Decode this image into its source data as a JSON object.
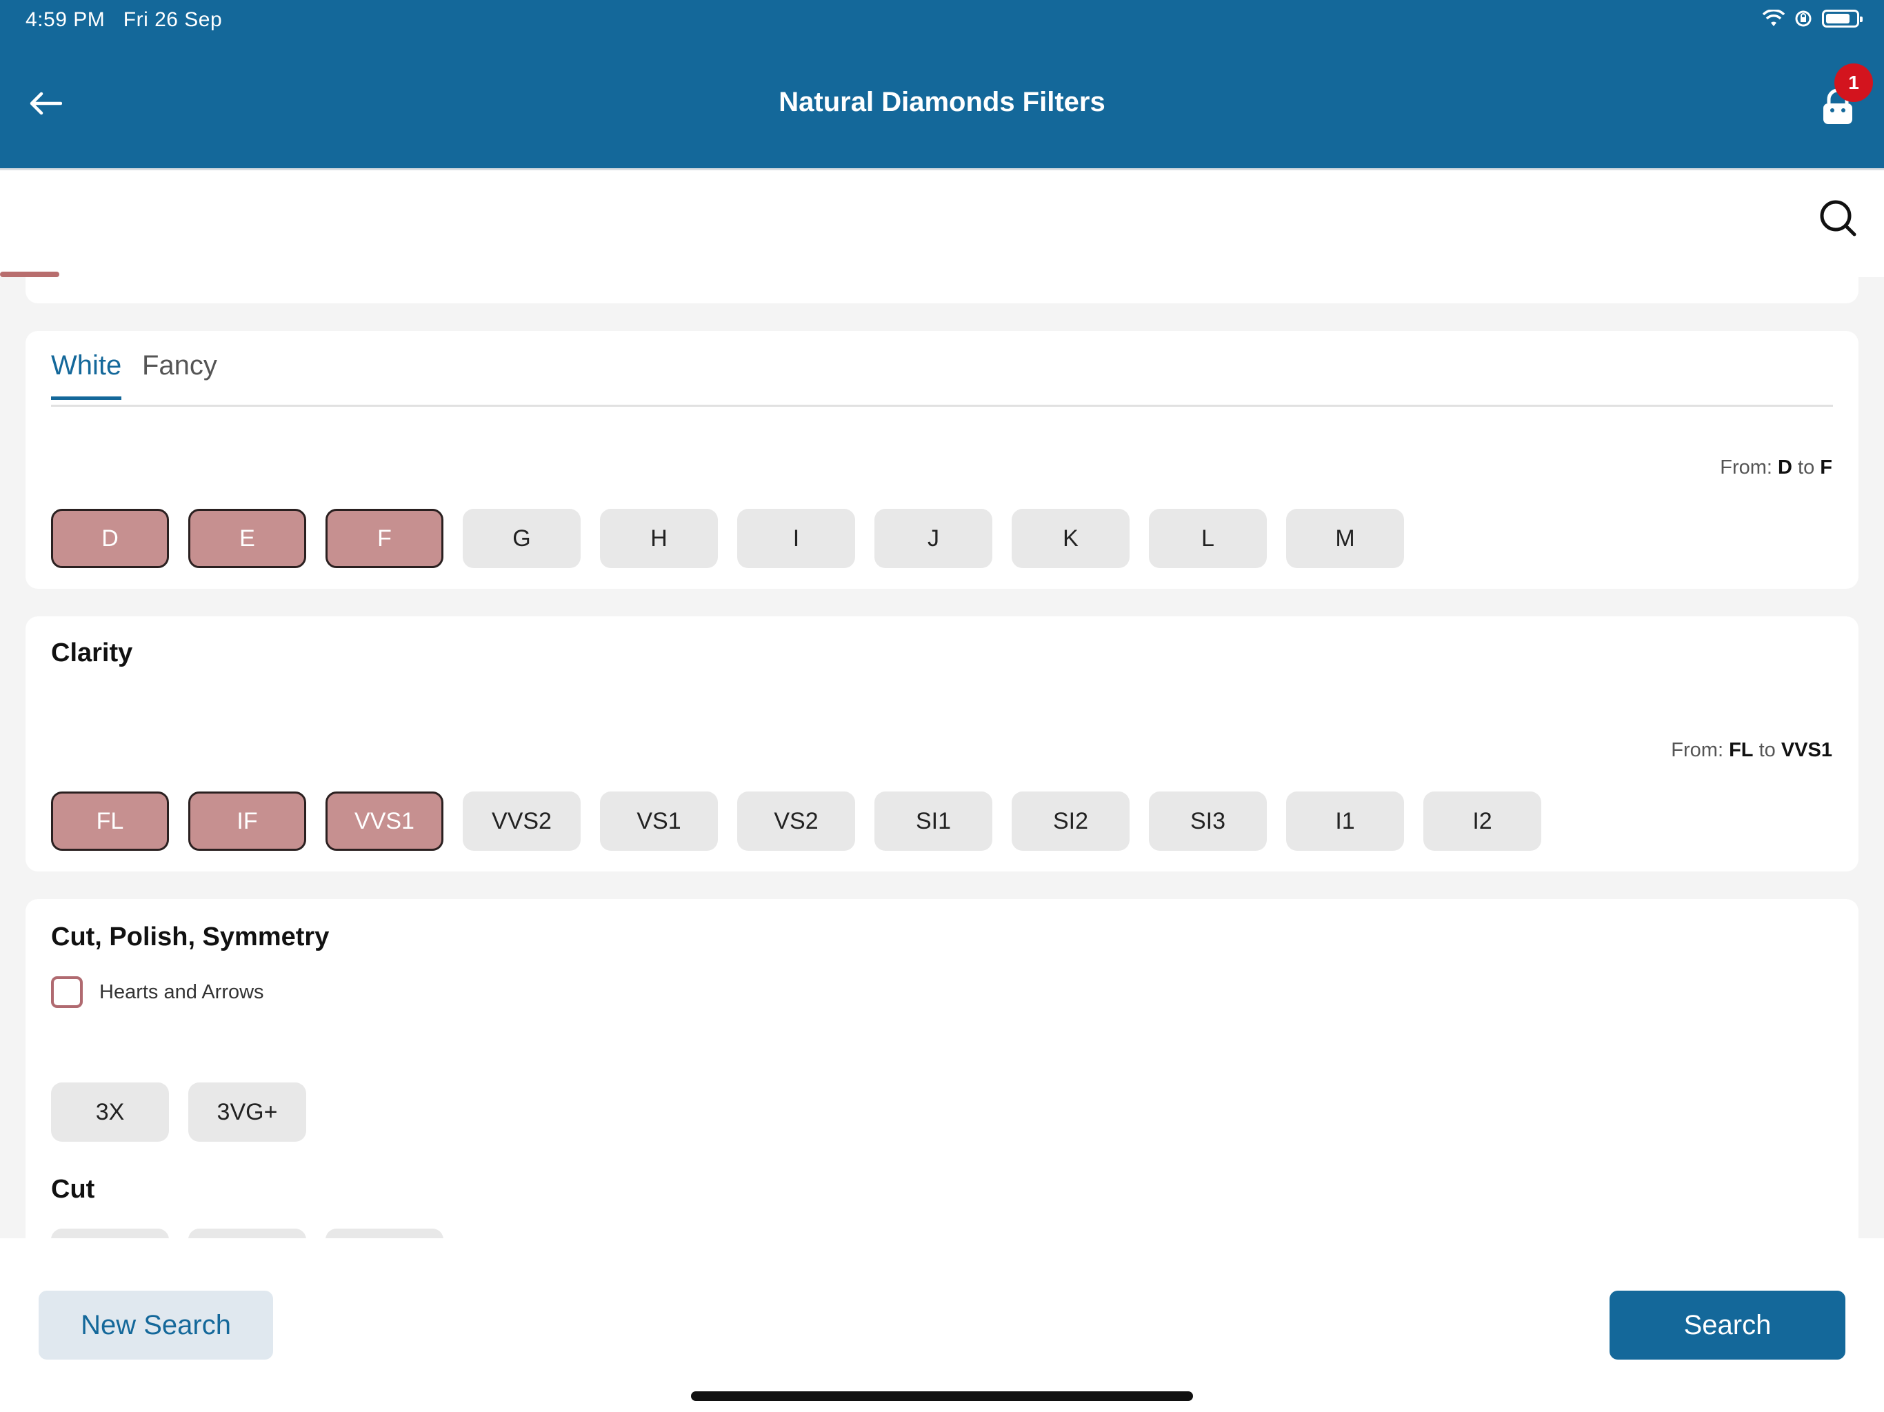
{
  "status_bar": {
    "time": "4:59 PM",
    "date": "Fri 26 Sep"
  },
  "header": {
    "title": "Natural Diamonds Filters",
    "cart_count": "1"
  },
  "colour": {
    "tabs": [
      {
        "label": "White",
        "active": true
      },
      {
        "label": "Fancy",
        "active": false
      }
    ],
    "range": {
      "prefix": "From:",
      "from": "D",
      "mid": "to",
      "to": "F"
    },
    "options": [
      {
        "label": "D",
        "selected": true
      },
      {
        "label": "E",
        "selected": true
      },
      {
        "label": "F",
        "selected": true
      },
      {
        "label": "G",
        "selected": false
      },
      {
        "label": "H",
        "selected": false
      },
      {
        "label": "I",
        "selected": false
      },
      {
        "label": "J",
        "selected": false
      },
      {
        "label": "K",
        "selected": false
      },
      {
        "label": "L",
        "selected": false
      },
      {
        "label": "M",
        "selected": false
      }
    ]
  },
  "clarity": {
    "title": "Clarity",
    "range": {
      "prefix": "From:",
      "from": "FL",
      "mid": "to",
      "to": "VVS1"
    },
    "options": [
      {
        "label": "FL",
        "selected": true
      },
      {
        "label": "IF",
        "selected": true
      },
      {
        "label": "VVS1",
        "selected": true
      },
      {
        "label": "VVS2",
        "selected": false
      },
      {
        "label": "VS1",
        "selected": false
      },
      {
        "label": "VS2",
        "selected": false
      },
      {
        "label": "SI1",
        "selected": false
      },
      {
        "label": "SI2",
        "selected": false
      },
      {
        "label": "SI3",
        "selected": false
      },
      {
        "label": "I1",
        "selected": false
      },
      {
        "label": "I2",
        "selected": false
      }
    ]
  },
  "cut_polish_symmetry": {
    "title": "Cut, Polish, Symmetry",
    "checkbox_label": "Hearts and Arrows",
    "options": [
      {
        "label": "3X",
        "selected": false
      },
      {
        "label": "3VG+",
        "selected": false
      }
    ],
    "cut_title": "Cut"
  },
  "footer": {
    "new_search_label": "New Search",
    "search_label": "Search"
  },
  "colors": {
    "primary": "#14689a",
    "selected_chip": "#c69090",
    "badge": "#d3141e"
  }
}
